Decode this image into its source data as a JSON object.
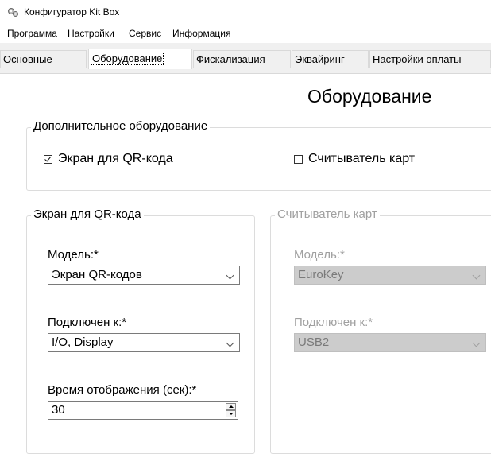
{
  "window": {
    "title": "Конфигуратор Kit Box",
    "icon": "gear-icon"
  },
  "menu": [
    "Программа",
    "Настройки",
    "Сервис",
    "Информация"
  ],
  "tabs": [
    {
      "label": "Основные",
      "active": false
    },
    {
      "label": "Оборудование",
      "active": true
    },
    {
      "label": "Фискализация",
      "active": false
    },
    {
      "label": "Эквайринг",
      "active": false
    },
    {
      "label": "Настройки оплаты",
      "active": false
    }
  ],
  "page": {
    "title": "Оборудование"
  },
  "additional_equipment": {
    "legend": "Дополнительное оборудование",
    "qr_screen": {
      "label": "Экран для QR-кода",
      "checked": true
    },
    "card_reader": {
      "label": "Считыватель карт",
      "checked": false
    }
  },
  "qr_screen_group": {
    "legend": "Экран для QR-кода",
    "model_label": "Модель:*",
    "model_value": "Экран QR-кодов",
    "connected_label": "Подключен к:*",
    "connected_value": "I/O, Display",
    "display_time_label": "Время отображения (сек):*",
    "display_time_value": "30"
  },
  "card_reader_group": {
    "legend": "Считыватель карт",
    "enabled": false,
    "model_label": "Модель:*",
    "model_value": "EuroKey",
    "connected_label": "Подключен к:*",
    "connected_value": "USB2"
  },
  "colors": {
    "tabstrip_bg": "#f0f0f0",
    "disabled_text": "#a0a0a0",
    "disabled_field_bg": "#cccccc"
  }
}
